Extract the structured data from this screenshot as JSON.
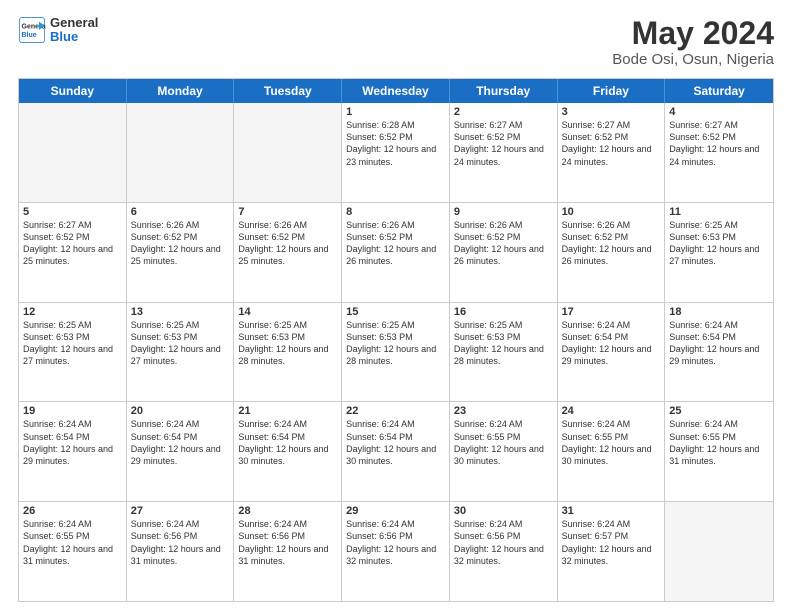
{
  "header": {
    "logo_line1": "General",
    "logo_line2": "Blue",
    "title": "May 2024",
    "subtitle": "Bode Osi, Osun, Nigeria"
  },
  "days": [
    "Sunday",
    "Monday",
    "Tuesday",
    "Wednesday",
    "Thursday",
    "Friday",
    "Saturday"
  ],
  "weeks": [
    [
      {
        "day": "",
        "empty": true
      },
      {
        "day": "",
        "empty": true
      },
      {
        "day": "",
        "empty": true
      },
      {
        "day": "1",
        "sunrise": "6:28 AM",
        "sunset": "6:52 PM",
        "daylight": "12 hours and 23 minutes."
      },
      {
        "day": "2",
        "sunrise": "6:27 AM",
        "sunset": "6:52 PM",
        "daylight": "12 hours and 24 minutes."
      },
      {
        "day": "3",
        "sunrise": "6:27 AM",
        "sunset": "6:52 PM",
        "daylight": "12 hours and 24 minutes."
      },
      {
        "day": "4",
        "sunrise": "6:27 AM",
        "sunset": "6:52 PM",
        "daylight": "12 hours and 24 minutes."
      }
    ],
    [
      {
        "day": "5",
        "sunrise": "6:27 AM",
        "sunset": "6:52 PM",
        "daylight": "12 hours and 25 minutes."
      },
      {
        "day": "6",
        "sunrise": "6:26 AM",
        "sunset": "6:52 PM",
        "daylight": "12 hours and 25 minutes."
      },
      {
        "day": "7",
        "sunrise": "6:26 AM",
        "sunset": "6:52 PM",
        "daylight": "12 hours and 25 minutes."
      },
      {
        "day": "8",
        "sunrise": "6:26 AM",
        "sunset": "6:52 PM",
        "daylight": "12 hours and 26 minutes."
      },
      {
        "day": "9",
        "sunrise": "6:26 AM",
        "sunset": "6:52 PM",
        "daylight": "12 hours and 26 minutes."
      },
      {
        "day": "10",
        "sunrise": "6:26 AM",
        "sunset": "6:52 PM",
        "daylight": "12 hours and 26 minutes."
      },
      {
        "day": "11",
        "sunrise": "6:25 AM",
        "sunset": "6:53 PM",
        "daylight": "12 hours and 27 minutes."
      }
    ],
    [
      {
        "day": "12",
        "sunrise": "6:25 AM",
        "sunset": "6:53 PM",
        "daylight": "12 hours and 27 minutes."
      },
      {
        "day": "13",
        "sunrise": "6:25 AM",
        "sunset": "6:53 PM",
        "daylight": "12 hours and 27 minutes."
      },
      {
        "day": "14",
        "sunrise": "6:25 AM",
        "sunset": "6:53 PM",
        "daylight": "12 hours and 28 minutes."
      },
      {
        "day": "15",
        "sunrise": "6:25 AM",
        "sunset": "6:53 PM",
        "daylight": "12 hours and 28 minutes."
      },
      {
        "day": "16",
        "sunrise": "6:25 AM",
        "sunset": "6:53 PM",
        "daylight": "12 hours and 28 minutes."
      },
      {
        "day": "17",
        "sunrise": "6:24 AM",
        "sunset": "6:54 PM",
        "daylight": "12 hours and 29 minutes."
      },
      {
        "day": "18",
        "sunrise": "6:24 AM",
        "sunset": "6:54 PM",
        "daylight": "12 hours and 29 minutes."
      }
    ],
    [
      {
        "day": "19",
        "sunrise": "6:24 AM",
        "sunset": "6:54 PM",
        "daylight": "12 hours and 29 minutes."
      },
      {
        "day": "20",
        "sunrise": "6:24 AM",
        "sunset": "6:54 PM",
        "daylight": "12 hours and 29 minutes."
      },
      {
        "day": "21",
        "sunrise": "6:24 AM",
        "sunset": "6:54 PM",
        "daylight": "12 hours and 30 minutes."
      },
      {
        "day": "22",
        "sunrise": "6:24 AM",
        "sunset": "6:54 PM",
        "daylight": "12 hours and 30 minutes."
      },
      {
        "day": "23",
        "sunrise": "6:24 AM",
        "sunset": "6:55 PM",
        "daylight": "12 hours and 30 minutes."
      },
      {
        "day": "24",
        "sunrise": "6:24 AM",
        "sunset": "6:55 PM",
        "daylight": "12 hours and 30 minutes."
      },
      {
        "day": "25",
        "sunrise": "6:24 AM",
        "sunset": "6:55 PM",
        "daylight": "12 hours and 31 minutes."
      }
    ],
    [
      {
        "day": "26",
        "sunrise": "6:24 AM",
        "sunset": "6:55 PM",
        "daylight": "12 hours and 31 minutes."
      },
      {
        "day": "27",
        "sunrise": "6:24 AM",
        "sunset": "6:56 PM",
        "daylight": "12 hours and 31 minutes."
      },
      {
        "day": "28",
        "sunrise": "6:24 AM",
        "sunset": "6:56 PM",
        "daylight": "12 hours and 31 minutes."
      },
      {
        "day": "29",
        "sunrise": "6:24 AM",
        "sunset": "6:56 PM",
        "daylight": "12 hours and 32 minutes."
      },
      {
        "day": "30",
        "sunrise": "6:24 AM",
        "sunset": "6:56 PM",
        "daylight": "12 hours and 32 minutes."
      },
      {
        "day": "31",
        "sunrise": "6:24 AM",
        "sunset": "6:57 PM",
        "daylight": "12 hours and 32 minutes."
      },
      {
        "day": "",
        "empty": true
      }
    ]
  ]
}
